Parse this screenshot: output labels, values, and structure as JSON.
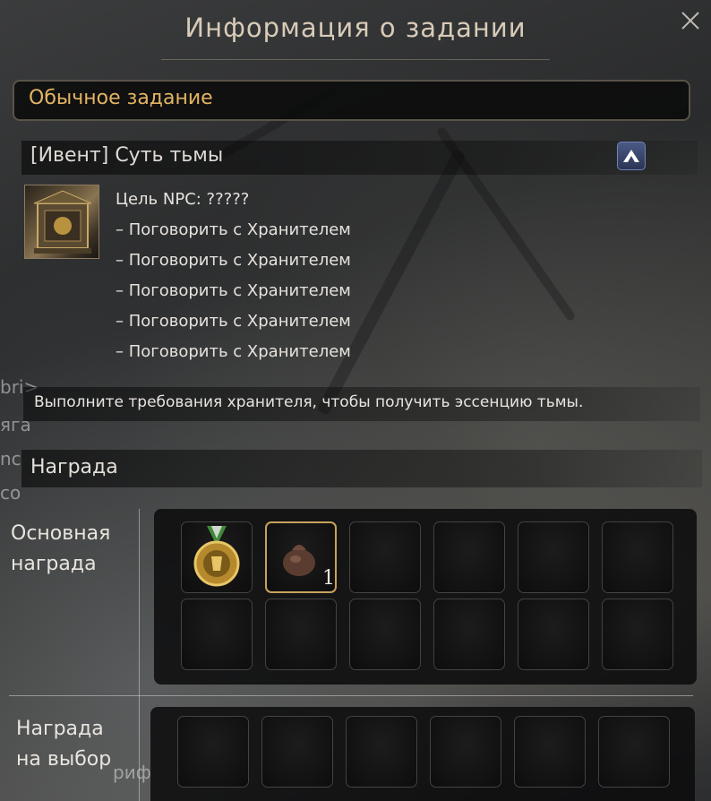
{
  "window": {
    "title": "Информация о задании",
    "close_icon": "close-icon"
  },
  "quest_type": {
    "label": "Обычное задание",
    "color": "#e3b463"
  },
  "quest": {
    "name": "[Ивент] Суть тьмы",
    "npc_target": "Цель NPC: ?????",
    "objectives": [
      "– Поговорить с Хранителем",
      "– Поговорить с Хранителем",
      "– Поговорить с Хранителем",
      "– Поговорить с Хранителем",
      "– Поговорить с Хранителем"
    ],
    "description": "Выполните требования хранителя, чтобы получить эссенцию тьмы."
  },
  "rewards": {
    "header": "Награда",
    "main_label_line1": "Основная",
    "main_label_line2": "награда",
    "choice_label_line1": "Награда",
    "choice_label_line2": "на выбор",
    "main_items": [
      {
        "icon": "medal-icon",
        "count": ""
      },
      {
        "icon": "essence-pouch-icon",
        "count": "1"
      }
    ]
  },
  "background_text": {
    "edge1": "bri>",
    "edge2": "яга",
    "edge3": "nc",
    "edge4": "co",
    "edge5": "риф"
  }
}
